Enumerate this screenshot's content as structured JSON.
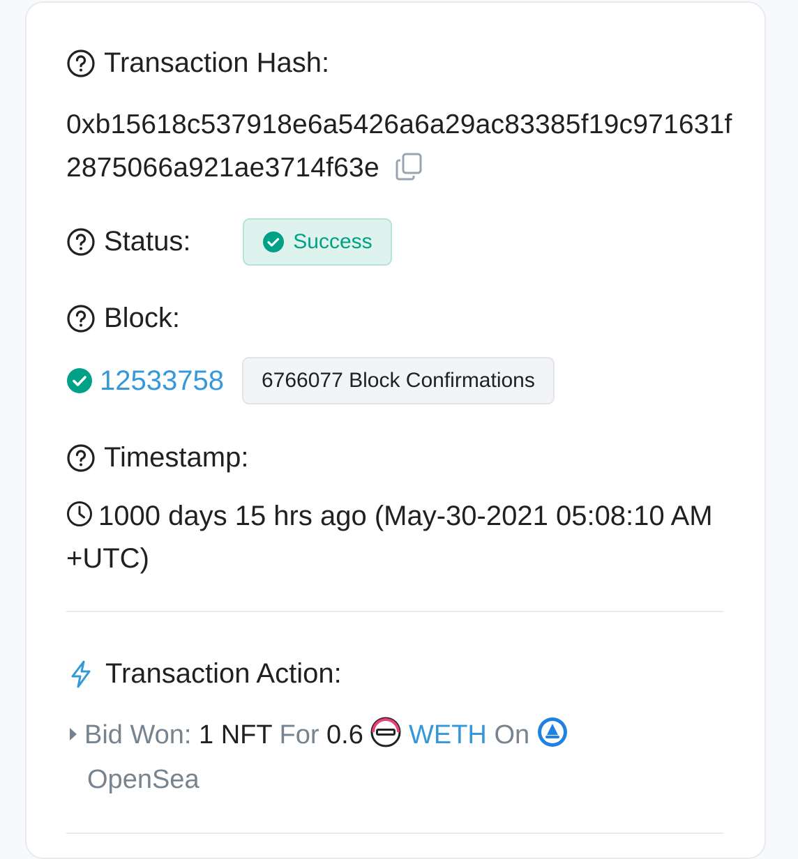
{
  "transaction_hash": {
    "label": "Transaction Hash:",
    "value": "0xb15618c537918e6a5426a6a29ac83385f19c971631f2875066a921ae3714f63e",
    "copy_icon": "copy-icon"
  },
  "status": {
    "label": "Status:",
    "value": "Success",
    "color": "#00a186"
  },
  "block": {
    "label": "Block:",
    "number": "12533758",
    "confirmations": "6766077 Block Confirmations"
  },
  "timestamp": {
    "label": "Timestamp:",
    "value": "1000 days 15 hrs ago (May-30-2021 05:08:10 AM +UTC)"
  },
  "transaction_action": {
    "label": "Transaction Action:",
    "prefix": "Bid Won:",
    "quantity": "1 NFT",
    "for_word": "For",
    "amount": "0.6",
    "token": "WETH",
    "on_word": "On",
    "marketplace": "OpenSea"
  },
  "colors": {
    "link": "#3498db",
    "success": "#00a186",
    "text": "#1e2022",
    "muted": "#77838f"
  }
}
